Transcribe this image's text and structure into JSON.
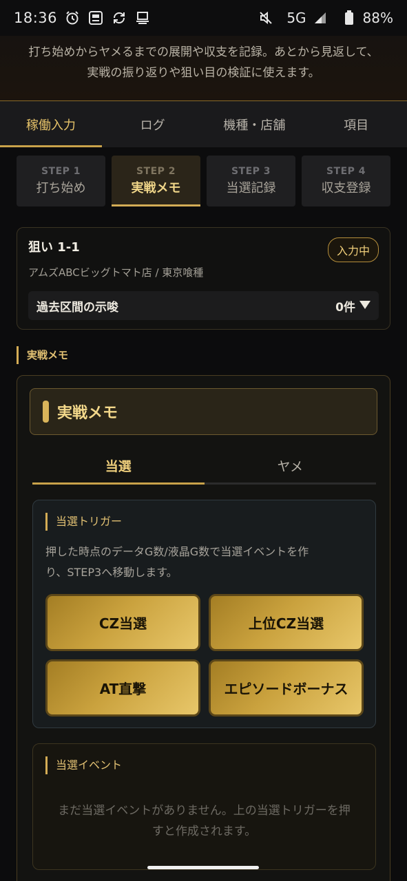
{
  "status": {
    "time": "18:36",
    "network": "5G",
    "battery": "88%",
    "icons": [
      "alarm-icon",
      "app-icon",
      "sync-icon",
      "cast-icon",
      "mute-icon",
      "signal-icon",
      "battery-icon"
    ]
  },
  "intro": {
    "line1": "打ち始めからヤメるまでの展開や収支を記録。あとから見返して、",
    "line2": "実戦の振り返りや狙い目の検証に使えます。"
  },
  "main_tabs": [
    {
      "label": "稼働入力",
      "active": true
    },
    {
      "label": "ログ",
      "active": false
    },
    {
      "label": "機種・店舗",
      "active": false
    },
    {
      "label": "項目",
      "active": false
    }
  ],
  "steps": [
    {
      "num": "STEP 1",
      "label": "打ち始め",
      "active": false
    },
    {
      "num": "STEP 2",
      "label": "実戦メモ",
      "active": true
    },
    {
      "num": "STEP 3",
      "label": "当選記録",
      "active": false
    },
    {
      "num": "STEP 4",
      "label": "収支登録",
      "active": false
    }
  ],
  "session": {
    "title": "狙い 1-1",
    "badge": "入力中",
    "subtitle": "アムズABCビッグトマト店 / 東京喰種",
    "hint_label": "過去区間の示唆",
    "hint_count": "0件"
  },
  "section_label": "実戦メモ",
  "memo": {
    "title": "実戦メモ",
    "subtabs": [
      {
        "label": "当選",
        "active": true
      },
      {
        "label": "ヤメ",
        "active": false
      }
    ],
    "trigger": {
      "label": "当選トリガー",
      "desc_line1": "押した時点のデータG数/液晶G数で当選イベントを作",
      "desc_line2": "り、STEP3へ移動します。",
      "buttons": [
        "CZ当選",
        "上位CZ当選",
        "AT直撃",
        "エピソードボーナス"
      ]
    },
    "events": {
      "label": "当選イベント",
      "empty_line1": "まだ当選イベントがありません。上の当選トリガーを押",
      "empty_line2": "すと作成されます。"
    }
  },
  "colors": {
    "accent": "#d4ac55",
    "background": "#0c0c0d",
    "button_gold": "#caa23e"
  }
}
